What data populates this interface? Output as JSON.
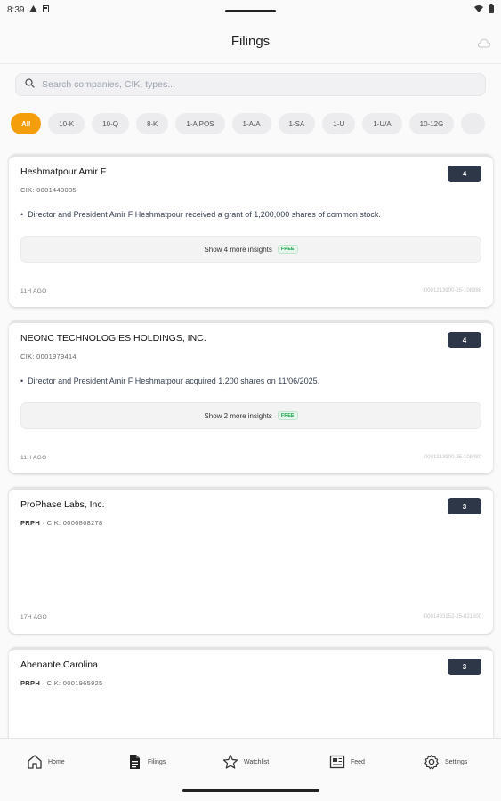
{
  "status_bar": {
    "time": "8:39"
  },
  "header": {
    "title": "Filings"
  },
  "search": {
    "placeholder": "Search companies, CIK, types..."
  },
  "filters": [
    "All",
    "10-K",
    "10-Q",
    "8-K",
    "1-A POS",
    "1-A/A",
    "1-SA",
    "1-U",
    "1-U/A",
    "10-12G"
  ],
  "active_filter": "All",
  "cards": [
    {
      "title": "Heshmatpour Amir F",
      "ticker": "",
      "cik": "CIK: 0001443035",
      "badge": "4",
      "insight": "Director and President Amir F Heshmatpour received a grant of 1,200,000 shares of common stock.",
      "more_label": "Show 4 more insights",
      "free_label": "FREE",
      "time": "11H AGO",
      "accession": "0001213900-25-108988"
    },
    {
      "title": "NEONC TECHNOLOGIES HOLDINGS, INC.",
      "ticker": "",
      "cik": "CIK: 0001979414",
      "badge": "4",
      "insight": "Director and President Amir F Heshmatpour acquired 1,200 shares on 11/06/2025.",
      "more_label": "Show 2 more insights",
      "free_label": "FREE",
      "time": "11H AGO",
      "accession": "0001213900-25-108480"
    },
    {
      "title": "ProPhase Labs, Inc.",
      "ticker": "PRPH",
      "cik": "· CIK: 0000868278",
      "badge": "3",
      "time": "17H AGO",
      "accession": "0001493152-25-021600"
    },
    {
      "title": "Abenante Carolina",
      "ticker": "PRPH",
      "cik": "· CIK: 0001965925",
      "badge": "3"
    }
  ],
  "nav": [
    {
      "label": "Home",
      "icon": "home-icon"
    },
    {
      "label": "Filings",
      "icon": "document-icon"
    },
    {
      "label": "Watchlist",
      "icon": "star-icon"
    },
    {
      "label": "Feed",
      "icon": "newspaper-icon"
    },
    {
      "label": "Settings",
      "icon": "gear-icon"
    }
  ],
  "colors": {
    "accent": "#f59e0b",
    "badge": "#2d3748",
    "free": "#16a34a"
  }
}
